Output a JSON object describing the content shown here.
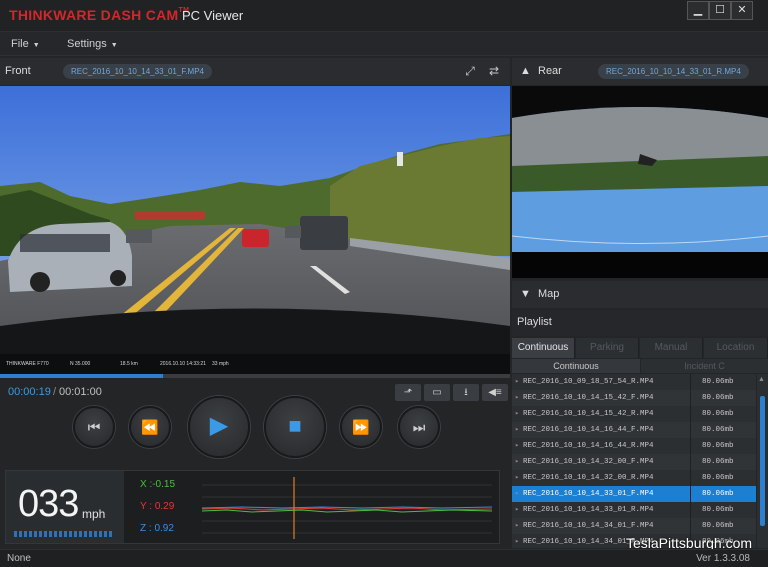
{
  "window": {
    "brand": "THINKWARE DASH CAM",
    "brand_mark": "TM",
    "product": "PC Viewer",
    "minimize": "▁",
    "maximize": "☐",
    "close": "✕"
  },
  "menu": {
    "file": "File",
    "settings": "Settings"
  },
  "front": {
    "label": "Front",
    "file": "REC_2016_10_10_14_33_01_F.MP4"
  },
  "rear": {
    "label": "Rear",
    "file": "REC_2016_10_10_14_33_01_R.MP4"
  },
  "overlay": {
    "cam": "THINKWARE F770",
    "coord1": "N 35.000",
    "coord2": "18.5 km",
    "date": "2016.10.10 14:33:21",
    "speed": "33 mph"
  },
  "playback": {
    "current": "00:00:19",
    "separator": "/",
    "total": "00:01:00",
    "progress": 0.32
  },
  "gauge": {
    "speed": "033",
    "unit": "mph",
    "x": "X :-0.15",
    "y": "Y : 0.29",
    "z": "Z : 0.92",
    "colors": {
      "x": "#4cbf3c",
      "y": "#e03a3a",
      "z": "#3a8fe0"
    }
  },
  "map": {
    "label": "Map"
  },
  "playlist": {
    "title": "Playlist",
    "tabs": [
      "Continuous",
      "Parking",
      "Manual",
      "Location"
    ],
    "subtabs": [
      "Continuous",
      "Incident C"
    ],
    "rows": [
      {
        "name": "REC_2016_10_09_18_57_54_R.MP4",
        "size": "80.06mb"
      },
      {
        "name": "REC_2016_10_10_14_15_42_F.MP4",
        "size": "80.06mb"
      },
      {
        "name": "REC_2016_10_10_14_15_42_R.MP4",
        "size": "80.06mb"
      },
      {
        "name": "REC_2016_10_10_14_16_44_F.MP4",
        "size": "80.06mb"
      },
      {
        "name": "REC_2016_10_10_14_16_44_R.MP4",
        "size": "80.06mb"
      },
      {
        "name": "REC_2016_10_10_14_32_00_F.MP4",
        "size": "80.06mb"
      },
      {
        "name": "REC_2016_10_10_14_32_00_R.MP4",
        "size": "80.06mb"
      },
      {
        "name": "REC_2016_10_10_14_33_01_F.MP4",
        "size": "80.06mb",
        "selected": true
      },
      {
        "name": "REC_2016_10_10_14_33_01_R.MP4",
        "size": "80.06mb"
      },
      {
        "name": "REC_2016_10_10_14_34_01_F.MP4",
        "size": "80.06mb"
      },
      {
        "name": "REC_2016_10_10_14_34_01_R.MP4",
        "size": "80.06mb"
      }
    ]
  },
  "status": {
    "left": "None",
    "version": "Ver 1.3.3.08"
  },
  "watermark": "TeslaPittsburgh.com",
  "accent": "#2f7fd0",
  "icons": [
    "fullscreen-icon",
    "swap-icon",
    "capture-icon",
    "window-icon",
    "download-icon",
    "volume-icon",
    "skip-start-icon",
    "rewind-icon",
    "play-icon",
    "stop-icon",
    "fast-forward-icon",
    "skip-end-icon"
  ]
}
